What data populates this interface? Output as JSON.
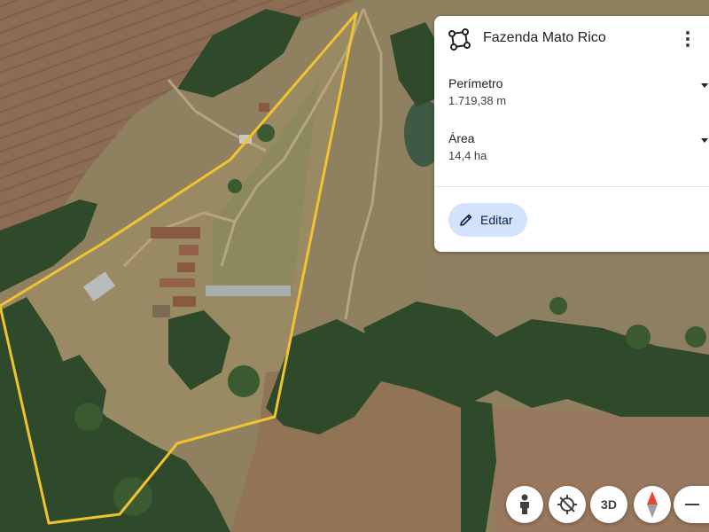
{
  "place": {
    "title": "Fazenda Mato Rico",
    "icon": "polygon-measure-icon"
  },
  "metrics": {
    "perimeter": {
      "label": "Perímetro",
      "value": "1.719,38 m"
    },
    "area": {
      "label": "Área",
      "value": "14,4 ha"
    }
  },
  "actions": {
    "edit_label": "Editar",
    "more_icon": "more-vertical-icon",
    "dropdown_icon": "caret-down-icon"
  },
  "controls": {
    "pegman_icon": "pegman-icon",
    "recenter_icon": "location-off-icon",
    "three_d_label": "3D",
    "compass_icon": "compass-icon",
    "zoom_out_icon": "minus-icon"
  },
  "colors": {
    "boundary": "#f2c230",
    "edit_button_bg": "#d3e3fd",
    "compass_north": "#e8453c"
  }
}
